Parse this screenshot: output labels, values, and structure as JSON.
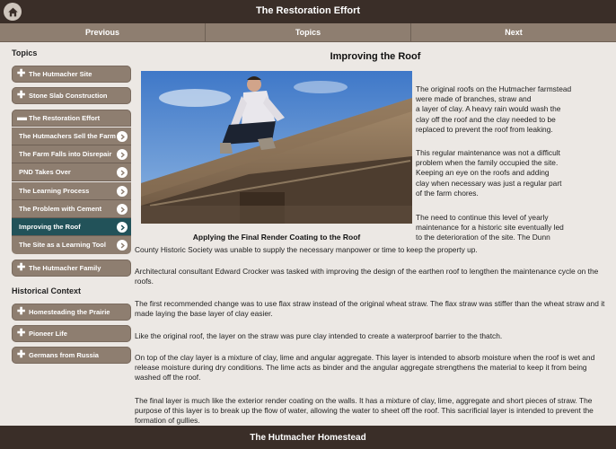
{
  "header": {
    "title": "The Restoration Effort"
  },
  "nav": {
    "previous": "Previous",
    "topics": "Topics",
    "next": "Next"
  },
  "sidebar": {
    "topics_title": "Topics",
    "hutmacher_site": "The Hutmacher Site",
    "stone_slab": "Stone Slab Construction",
    "restoration_effort": "The Restoration Effort",
    "sub_items": [
      "The Hutmachers Sell the Farm",
      "The Farm Falls into Disrepair",
      "PND Takes Over",
      "The Learning Process",
      "The Problem with Cement",
      "Improving the Roof",
      "The Site as a Learning Tool"
    ],
    "hutmacher_family": "The Hutmacher Family",
    "historical_title": "Historical Context",
    "homesteading": "Homesteading the Prairie",
    "pioneer_life": "Pioneer Life",
    "germans_russia": "Germans from Russia"
  },
  "main": {
    "title": "Improving the Roof",
    "caption": "Applying the Final Render Coating to the Roof",
    "p1_lines": [
      "The original roofs on the Hutmacher farmstead",
      "were made of branches, straw and",
      "a layer of clay. A heavy rain would wash the",
      "clay off the roof and the clay needed to be",
      "replaced to prevent the roof from leaking."
    ],
    "p2_lines": [
      "This regular maintenance was not a difficult",
      "problem when the family occupied the site.",
      "Keeping an eye on the roofs and adding",
      "clay when necessary was just a regular part",
      "of the farm chores."
    ],
    "p3_lines": [
      "The need to continue this level of yearly",
      "maintenance for a historic site eventually led",
      "to the deterioration of the site. The Dunn"
    ],
    "p3_cont": "County Historic Society was unable to supply the necessary manpower or time to keep the property up.",
    "p4": "Architectural consultant Edward Crocker was tasked with improving the design of the earthen roof to lengthen the maintenance cycle on the roofs.",
    "p5": "The first recommended change was to use flax straw instead of the original wheat straw. The flax straw was stiffer than the wheat straw and it made laying the base layer of clay easier.",
    "p6": "Like the original roof, the layer on the straw was pure clay intended to create a waterproof barrier to the thatch.",
    "p7": "On top of the clay layer is a mixture of clay, lime and angular aggregate. This layer is intended to absorb moisture when the roof is wet and release moisture during dry conditions. The lime acts as binder and the angular aggregate strengthens the material to keep it from being washed off the roof.",
    "p8": "The final layer is much like the exterior render coating on the walls. It has a mixture of clay, lime, aggregate and short pieces of straw. The purpose of this layer is to break up the flow of water, allowing the water to sheet off the roof. This sacrificial layer is intended to prevent the formation of gullies."
  },
  "footer": {
    "title": "The Hutmacher Homestead"
  }
}
